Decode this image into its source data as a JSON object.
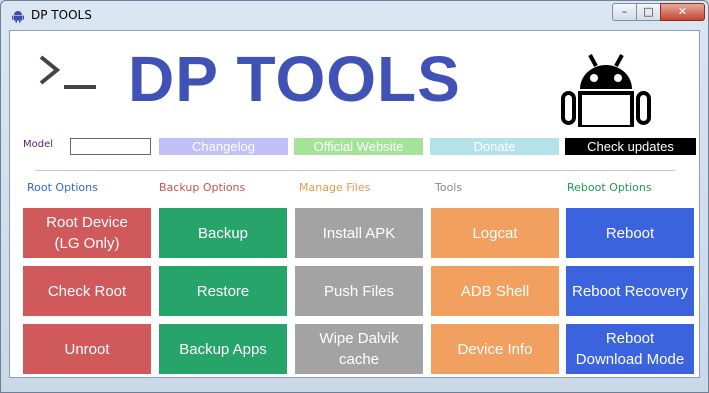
{
  "window": {
    "title": "DP TOOLS"
  },
  "brand": {
    "title": "DP TOOLS"
  },
  "colors": {
    "brand": "#4052b6",
    "red": "#d0595b",
    "green": "#26a469",
    "gray": "#a3a3a3",
    "orange": "#f2a05f",
    "blue": "#3b63dd"
  },
  "model": {
    "label": "Model",
    "value": ""
  },
  "links": {
    "changelog": "Changelog",
    "website": "Official Website",
    "donate": "Donate",
    "updates": "Check updates"
  },
  "sections": {
    "root": "Root Options",
    "backup": "Backup Options",
    "files": "Manage Files",
    "tools": "Tools",
    "reboot": "Reboot Options"
  },
  "buttons": {
    "root_device": "Root Device\n(LG Only)",
    "check_root": "Check Root",
    "unroot": "Unroot",
    "backup": "Backup",
    "restore": "Restore",
    "backup_apps": "Backup Apps",
    "install_apk": "Install APK",
    "push_files": "Push Files",
    "wipe_dalvik": "Wipe Dalvik\ncache",
    "logcat": "Logcat",
    "adb_shell": "ADB Shell",
    "device_info": "Device Info",
    "reboot": "Reboot",
    "reboot_recovery": "Reboot Recovery",
    "reboot_download": "Reboot\nDownload Mode"
  },
  "icons": {
    "app": "android-icon",
    "terminal": "terminal-prompt-icon",
    "logo": "android-robot-icon"
  }
}
